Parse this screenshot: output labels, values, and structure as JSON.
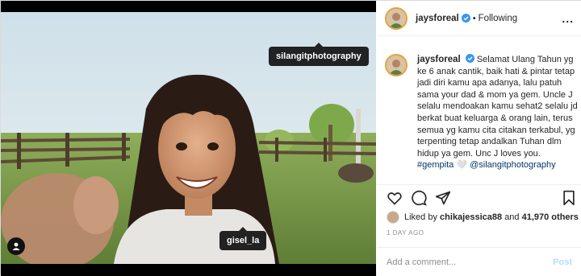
{
  "post": {
    "username": "jaysforeal",
    "separator": "•",
    "follow_status": "Following",
    "more_label": "...",
    "caption_parts": {
      "text": "Selamat Ulang Tahun yg ke 6 anak cantik, baik hati & pintar tetap jadi diri kamu apa adanya, lalu patuh sama your dad & mom ya gem. Uncle J selalu mendoakan kamu sehat2 selalu jd berkat buat keluarga & orang lain, terus semua yg kamu cita citakan terkabul, yg terpenting tetap andalkan Tuhan dlm hidup ya gem. Unc J loves you.",
      "hashtag": "#gempita",
      "emoji": "🤍",
      "mention": "@silangitphotography"
    },
    "likes": {
      "prefix": "Liked by",
      "liker": "chikajessica88",
      "conjunction": "and",
      "others": "41,970 others"
    },
    "time_ago": "1 DAY AGO",
    "comment_placeholder": "Add a comment...",
    "post_button": "Post"
  },
  "photo": {
    "tags": [
      "silangitphotography",
      "gisel_la"
    ]
  },
  "icons": {
    "verified": "verified-badge-icon",
    "like": "heart-icon",
    "comment": "comment-icon",
    "share": "share-icon",
    "save": "bookmark-icon",
    "user_tags": "user-tag-icon"
  },
  "colors": {
    "verified_blue": "#3897f0",
    "link_blue": "#00376b",
    "post_button_disabled": "#b2dffc"
  }
}
